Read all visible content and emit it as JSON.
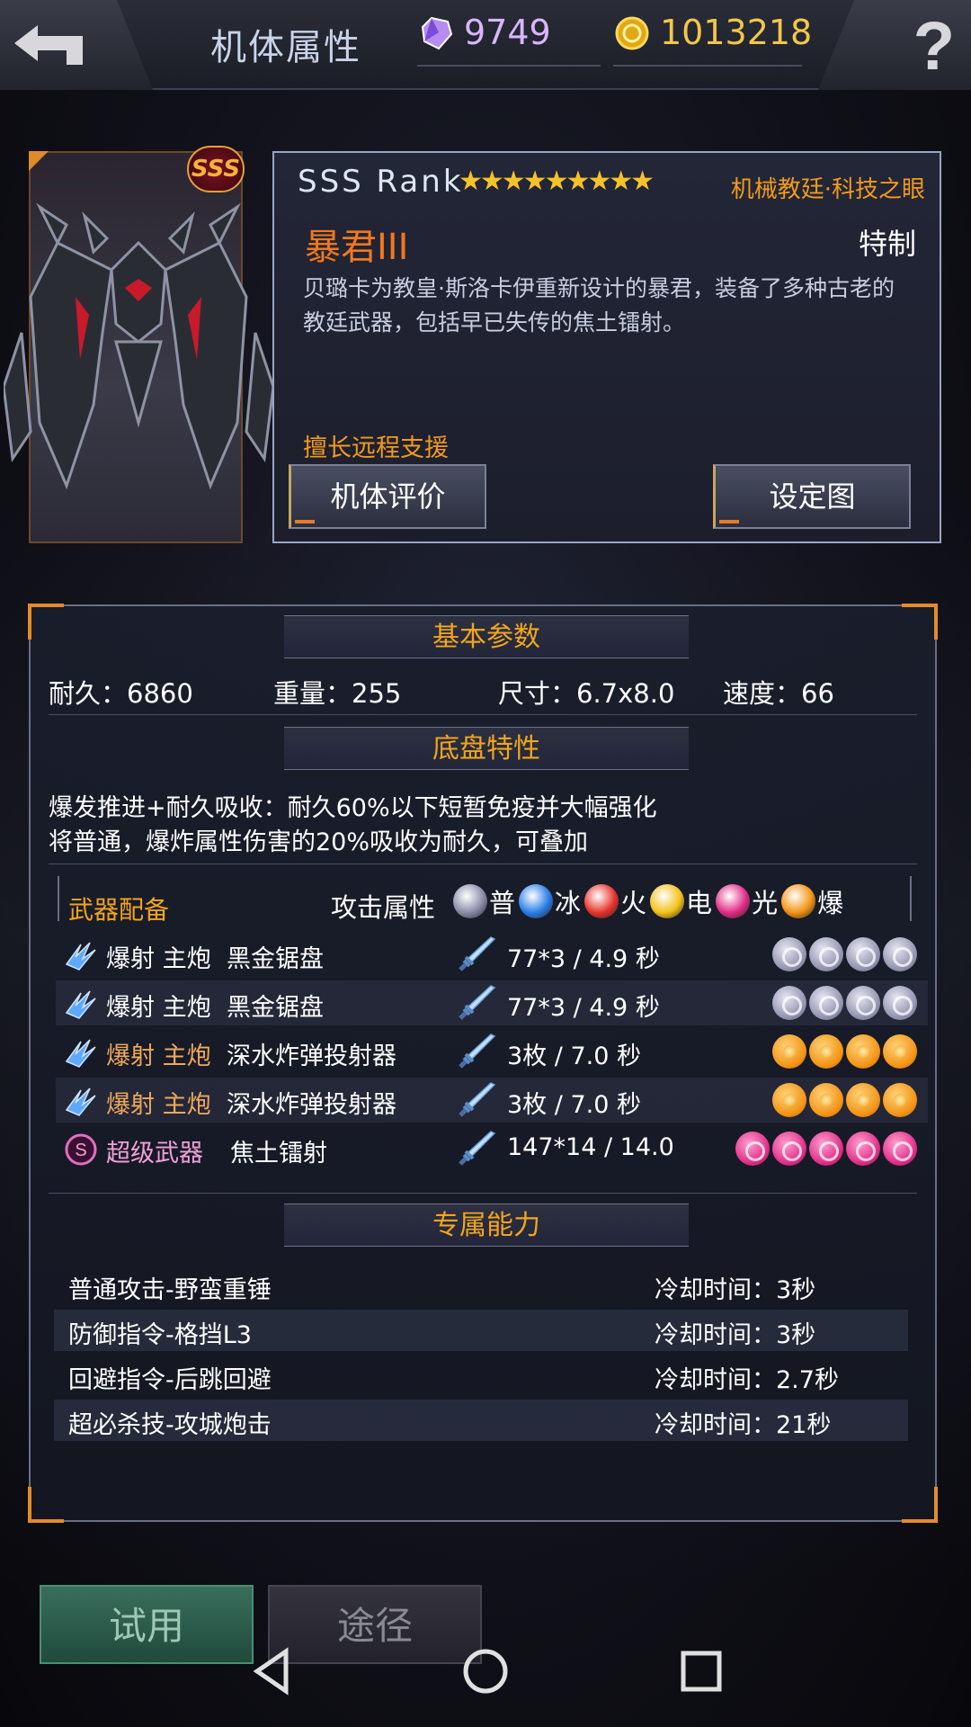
{
  "header": {
    "title": "机体属性",
    "gems": "9749",
    "coins": "1013218"
  },
  "mech": {
    "rank_badge": "SSS",
    "rank_text": "SSS  Rank",
    "stars": "★★★★★★★★★",
    "faction": "机械教廷·科技之眼",
    "name": "暴君III",
    "type": "特制",
    "description": "贝璐卡为教皇·斯洛卡伊重新设计的暴君，装备了多种古老的教廷武器，包括早已失传的焦土镭射。",
    "specialty": "擅长远程支援",
    "eval_button": "机体评价",
    "design_button": "设定图"
  },
  "sections": {
    "basic": "基本参数",
    "chassis": "底盘特性",
    "weapons": "武器配备",
    "attack_attr": "攻击属性",
    "abilities": "专属能力"
  },
  "params": {
    "durability": "耐久：6860",
    "weight": "重量：255",
    "size": "尺寸：6.7x8.0",
    "speed": "速度：66"
  },
  "chassis": {
    "line1": "爆发推进+耐久吸收：耐久60%以下短暂免疫并大幅强化",
    "line2": "将普通，爆炸属性伤害的20%吸收为耐久，可叠加"
  },
  "elements": [
    {
      "label": "普",
      "color": "#8b8ca8"
    },
    {
      "label": "冰",
      "color": "#2a7ee8"
    },
    {
      "label": "火",
      "color": "#e8342a"
    },
    {
      "label": "电",
      "color": "#f4c21a"
    },
    {
      "label": "光",
      "color": "#e02c86"
    },
    {
      "label": "爆",
      "color": "#f39415"
    }
  ],
  "weapons": [
    {
      "type": "爆射 主炮",
      "name": "黑金锯盘",
      "stat": "77*3 / 4.9 秒",
      "icon": "blaster-icon",
      "balls": [
        "gray",
        "gray",
        "gray",
        "gray"
      ]
    },
    {
      "type": "爆射 主炮",
      "name": "黑金锯盘",
      "stat": "77*3 / 4.9 秒",
      "icon": "blaster-icon",
      "balls": [
        "gray",
        "gray",
        "gray",
        "gray"
      ]
    },
    {
      "type": "爆射 主炮",
      "name": "深水炸弹投射器",
      "stat": "3枚 / 7.0 秒",
      "icon": "blaster-icon",
      "balls": [
        "orange",
        "orange",
        "orange",
        "orange"
      ]
    },
    {
      "type": "爆射 主炮",
      "name": "深水炸弹投射器",
      "stat": "3枚 / 7.0 秒",
      "icon": "blaster-icon",
      "balls": [
        "orange",
        "orange",
        "orange",
        "orange"
      ]
    },
    {
      "type": "超级武器",
      "name": "焦土镭射",
      "stat": "147*14 / 14.0",
      "icon": "super-weapon-icon",
      "balls": [
        "pink",
        "pink",
        "pink",
        "pink",
        "pink"
      ]
    }
  ],
  "abilities": [
    {
      "name": "普通攻击-野蛮重锤",
      "cooldown": "冷却时间：3秒"
    },
    {
      "name": "防御指令-格挡L3",
      "cooldown": "冷却时间：3秒"
    },
    {
      "name": "回避指令-后跳回避",
      "cooldown": "冷却时间：2.7秒"
    },
    {
      "name": "超必杀技-攻城炮击",
      "cooldown": "冷却时间：21秒"
    }
  ],
  "bottom": {
    "try": "试用",
    "route": "途径"
  }
}
